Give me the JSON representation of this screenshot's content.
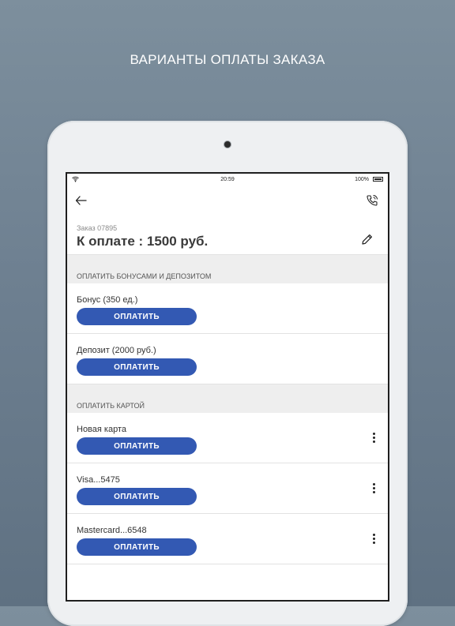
{
  "headline": "ВАРИАНТЫ ОПЛАТЫ ЗАКАЗА",
  "status_bar": {
    "time": "20:59",
    "battery": "100%"
  },
  "order": {
    "number": "Заказ 07895",
    "amount": "К оплате : 1500 руб."
  },
  "sections": [
    {
      "title": "ОПЛАТИТЬ БОНУСАМИ И ДЕПОЗИТОМ",
      "items": [
        {
          "label": "Бонус (350 ед.)",
          "button": "ОПЛАТИТЬ"
        },
        {
          "label": "Депозит (2000 руб.)",
          "button": "ОПЛАТИТЬ"
        }
      ]
    },
    {
      "title": "ОПЛАТИТЬ КАРТОЙ",
      "items": [
        {
          "label": "Новая карта",
          "button": "ОПЛАТИТЬ"
        },
        {
          "label": "Visa...5475",
          "button": "ОПЛАТИТЬ"
        },
        {
          "label": "Mastercard...6548",
          "button": "ОПЛАТИТЬ"
        }
      ]
    }
  ],
  "icons": {
    "back": "back-arrow-icon",
    "call": "phone-icon",
    "edit": "pencil-icon",
    "more": "more-vertical-icon",
    "wifi": "wifi-icon",
    "battery": "battery-icon"
  },
  "colors": {
    "accent": "#3359b3",
    "background": "#6e8091",
    "section_bg": "#eeeeee"
  }
}
